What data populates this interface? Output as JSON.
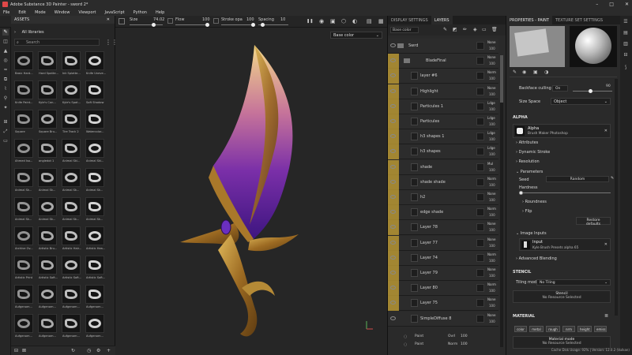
{
  "app": {
    "title": "Adobe Substance 3D Painter - sword 2*"
  },
  "window_controls": [
    "–",
    "□",
    "✕"
  ],
  "menu": [
    "File",
    "Edit",
    "Mode",
    "Window",
    "Viewport",
    "JavaScript",
    "Python",
    "Help"
  ],
  "toolbar": {
    "size_label": "Size",
    "size_value": "74.02",
    "size_level": 0.72,
    "flow_label": "Flow",
    "flow_value": "100",
    "stroke_label": "Stroke opa",
    "stroke_value": "100",
    "spacing_label": "Spacing",
    "spacing_value": "10"
  },
  "assets": {
    "header": "ASSETS",
    "library": "All libraries",
    "search_placeholder": "Search",
    "items": [
      "Basic Hard...",
      "Hard Spatte...",
      "Ink Splatte...",
      "Knife Uneve...",
      "Knife Paint...",
      "Kyle's Con...",
      "Kyle's Spat...",
      "Soft Shadow",
      "Square",
      "Square Bru...",
      "Tire Track 2",
      "Watercolor...",
      "Ahmed Isa...",
      "angledot 1",
      "Animal Ski...",
      "Animal Ski...",
      "Animal Sk...",
      "Animal Sk...",
      "Animal Sk...",
      "Animal Sk...",
      "Animal Sk...",
      "Animal Sk...",
      "Animal Sk...",
      "Animal Sk...",
      "Archive Ov...",
      "Artistic Bru...",
      "Artistic Hair...",
      "Artistic Hea...",
      "Artistic Print",
      "Artistic Soft...",
      "Artistic Soft...",
      "Artistic Soft...",
      "Aufgenom...",
      "Aufgenom...",
      "Aufgenom...",
      "Aufgenom...",
      "Aufgenom...",
      "Aufgenom...",
      "Aufgenom...",
      "Aufgenom..."
    ]
  },
  "viewport": {
    "channel": "Base color"
  },
  "layers_panel": {
    "tab_display": "DISPLAY SETTINGS",
    "tab_layers": "LAYERS",
    "channel": "Base color",
    "rows": [
      {
        "name": "Swrd",
        "blend": "None",
        "op": "100"
      },
      {
        "name": "BladeFinal",
        "blend": "None",
        "op": "100"
      },
      {
        "name": "layer #6",
        "blend": "Norm",
        "op": "100"
      },
      {
        "name": "Highlight",
        "blend": "None",
        "op": "100"
      },
      {
        "name": "Particules 1",
        "blend": "Ldge",
        "op": "100"
      },
      {
        "name": "Particules",
        "blend": "Ldge",
        "op": "100"
      },
      {
        "name": "h3 shapes 1",
        "blend": "Ldge",
        "op": "100"
      },
      {
        "name": "h3 shapes",
        "blend": "Ldge",
        "op": "100"
      },
      {
        "name": "shade",
        "blend": "Mul",
        "op": "100"
      },
      {
        "name": "shade shade",
        "blend": "Norm",
        "op": "100"
      },
      {
        "name": "h2",
        "blend": "None",
        "op": "100"
      },
      {
        "name": "edge shade",
        "blend": "Norm",
        "op": "100"
      },
      {
        "name": "Layer 78",
        "blend": "None",
        "op": "100"
      },
      {
        "name": "Layer 77",
        "blend": "None",
        "op": "100"
      },
      {
        "name": "Layer 74",
        "blend": "Norm",
        "op": "100"
      },
      {
        "name": "Layer 79",
        "blend": "None",
        "op": "100"
      },
      {
        "name": "Layer 80",
        "blend": "Norm",
        "op": "100"
      },
      {
        "name": "Layer 75",
        "blend": "None",
        "op": "100"
      },
      {
        "name": "SimpleDiffuse 8",
        "blend": "None",
        "op": "100"
      }
    ],
    "bottom": [
      {
        "name": "Paint",
        "blend": "Ovrl",
        "op": "100"
      },
      {
        "name": "Paint",
        "blend": "Norm",
        "op": "100"
      }
    ]
  },
  "properties": {
    "tab_paint": "PROPERTIES - PAINT",
    "tab_texture": "TEXTURE SET SETTINGS",
    "backface_label": "Backface culling",
    "backface_value": "On",
    "backface_num": "90",
    "size_space_label": "Size Space",
    "size_space_value": "Object",
    "alpha_title": "ALPHA",
    "alpha_name": "Alpha",
    "alpha_desc": "Brush Maker Photoshop",
    "attributes": "Attributes",
    "dynamic_stroke": "Dynamic Stroke",
    "resolution": "Resolution",
    "parameters": "Parameters",
    "seed_label": "Seed",
    "seed_value": "Random",
    "hardness_label": "Hardness",
    "roundness": "Roundness",
    "flip": "Flip",
    "restore": "Restore defaults",
    "image_inputs": "Image Inputs",
    "input_name": "Input",
    "input_desc": "Kyle Brush Presets alpha 65",
    "advanced_blending": "Advanced Blending",
    "stencil_title": "STENCIL",
    "tiling_label": "Tiling mode",
    "tiling_value": "No Tiling",
    "stencil_name": "Stencil",
    "no_resource": "No Resource Selected",
    "material_title": "MATERIAL",
    "mat_buttons": [
      "color",
      "metal",
      "rough",
      "nrm",
      "height",
      "emiss"
    ],
    "material_mode": "Material mode",
    "no_resource2": "No Resource Selected"
  },
  "status": {
    "text": "Cache Disk Usage:  92% | Version: 12.0.2 (Vulkan)"
  },
  "colors": {
    "accent": "#c9a434",
    "blade_top": "#e8c870",
    "blade_mid": "#b0569a",
    "blade_bottom": "#5a1f9a",
    "gold": "#a9782a"
  }
}
